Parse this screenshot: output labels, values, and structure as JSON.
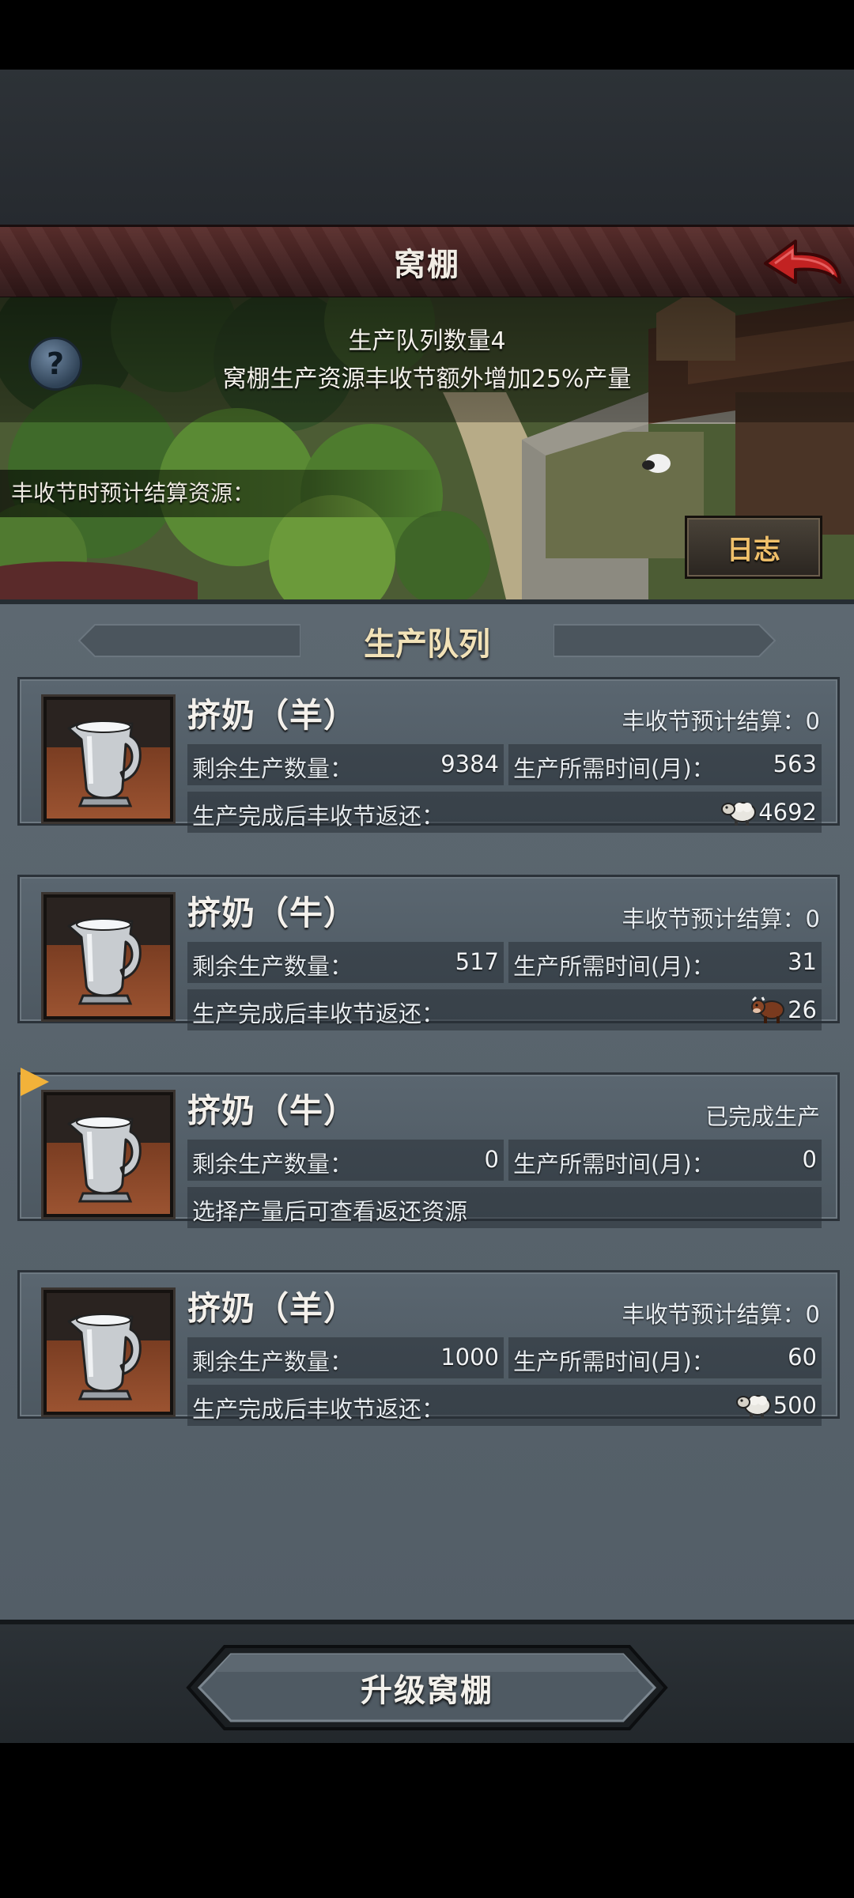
{
  "header": {
    "title": "窝棚"
  },
  "banner": {
    "queue_count": "生产队列数量4",
    "bonus_text": "窝棚生产资源丰收节额外增加25%产量",
    "settle_label": "丰收节时预计结算资源：",
    "log_button": "日志",
    "help_icon": "?"
  },
  "section": {
    "title": "生产队列"
  },
  "labels": {
    "remaining": "剩余生产数量：",
    "time": "生产所需时间(月)：",
    "return": "生产完成后丰收节返还："
  },
  "queue": [
    {
      "name": "挤奶（羊）",
      "status": "丰收节预计结算：0",
      "remaining": "9384",
      "time": "563",
      "bottom_text": "生产完成后丰收节返还：",
      "reward_icon": "sheep-icon",
      "reward": "4692",
      "selected": false
    },
    {
      "name": "挤奶（牛）",
      "status": "丰收节预计结算：0",
      "remaining": "517",
      "time": "31",
      "bottom_text": "生产完成后丰收节返还：",
      "reward_icon": "cow-icon",
      "reward": "26",
      "selected": false
    },
    {
      "name": "挤奶（牛）",
      "status": "已完成生产",
      "remaining": "0",
      "time": "0",
      "bottom_text": "选择产量后可查看返还资源",
      "reward_icon": "",
      "reward": "",
      "selected": true
    },
    {
      "name": "挤奶（羊）",
      "status": "丰收节预计结算：0",
      "remaining": "1000",
      "time": "60",
      "bottom_text": "生产完成后丰收节返还：",
      "reward_icon": "sheep-icon",
      "reward": "500",
      "selected": false
    }
  ],
  "footer": {
    "upgrade_button": "升级窝棚"
  },
  "colors": {
    "title_bar": "#4a2626",
    "panel": "#58636c",
    "accent": "#f2b23a",
    "log_text": "#f0c06a"
  }
}
